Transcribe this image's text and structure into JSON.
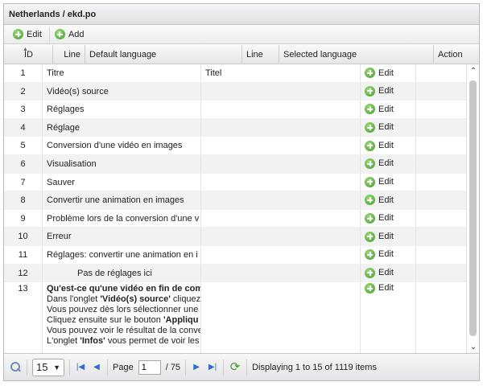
{
  "window": {
    "title": "Netherlands / ekd.po"
  },
  "toolbar": {
    "edit_label": "Edit",
    "add_label": "Add"
  },
  "columns": {
    "id": "ID",
    "line": "Line",
    "default": "Default language",
    "line2": "Line",
    "selected": "Selected language",
    "action": "Action"
  },
  "rows": [
    {
      "id": "1",
      "default": "Titre",
      "selected": "Titel",
      "action": "Edit"
    },
    {
      "id": "2",
      "default": "Vidéo(s) source",
      "selected": "",
      "action": "Edit"
    },
    {
      "id": "3",
      "default": "Réglages",
      "selected": "",
      "action": "Edit"
    },
    {
      "id": "4",
      "default": "Réglage",
      "selected": "",
      "action": "Edit"
    },
    {
      "id": "5",
      "default": "Conversion d'une vidéo en images",
      "selected": "",
      "action": "Edit"
    },
    {
      "id": "6",
      "default": "Visualisation",
      "selected": "",
      "action": "Edit"
    },
    {
      "id": "7",
      "default": "Sauver",
      "selected": "",
      "action": "Edit"
    },
    {
      "id": "8",
      "default": "Convertir une animation en images",
      "selected": "",
      "action": "Edit"
    },
    {
      "id": "9",
      "default": "Problème lors de la conversion d'une v",
      "selected": "",
      "action": "Edit"
    },
    {
      "id": "10",
      "default": "Erreur",
      "selected": "",
      "action": "Edit"
    },
    {
      "id": "11",
      "default": "Réglages: convertir une animation en i",
      "selected": "",
      "action": "Edit"
    },
    {
      "id": "12",
      "default": "Pas de réglages ici",
      "selected": "",
      "action": "Edit"
    }
  ],
  "row13": {
    "id": "13",
    "action": "Edit",
    "line1": "Qu'est-ce qu'une vidéo en fin de comp",
    "line2_pre": "Dans l'onglet ",
    "line2_bold": "'Vidéo(s) source'",
    "line2_post": " cliquez",
    "line3": "Vous pouvez dès lors sélectionner une",
    "line4_pre": "Cliquez ensuite sur le bouton ",
    "line4_bold": "'Appliqu",
    "line5": "Vous pouvez voir le résultat de la conve",
    "line6_pre": "L'onglet ",
    "line6_bold": "'Infos'",
    "line6_post": " vous permet de voir les"
  },
  "paging": {
    "page_size": "15",
    "page_label": "Page",
    "page_value": "1",
    "page_total": "/ 75",
    "display": "Displaying 1 to 15 of 1119 items"
  },
  "icons": {
    "add": "plus-circle-icon",
    "refresh": "refresh-icon",
    "search": "zoom-icon"
  },
  "colors": {
    "accent": "#3f9a2c",
    "nav": "#2f6fc9"
  }
}
